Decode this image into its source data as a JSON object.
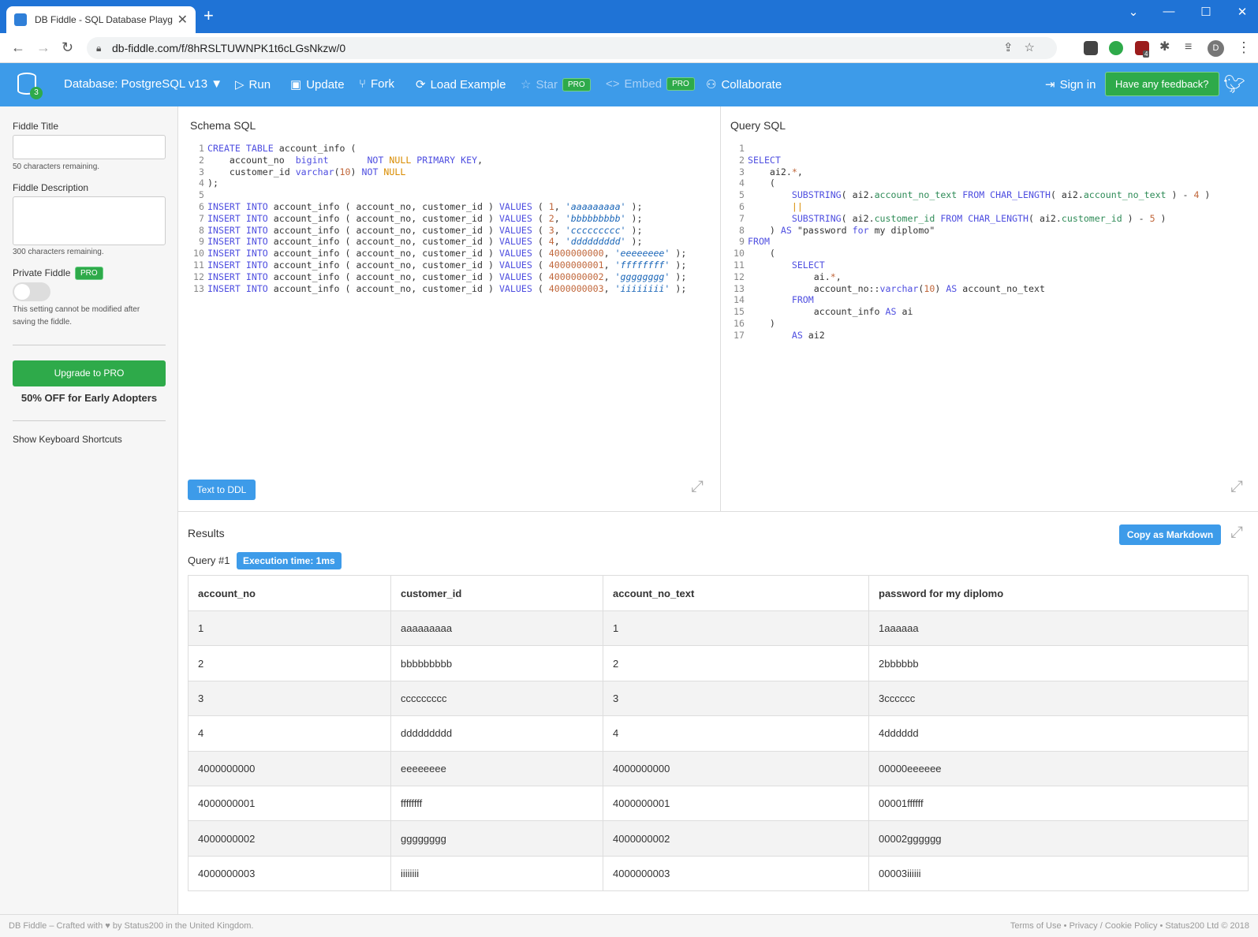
{
  "browser": {
    "tab_title": "DB Fiddle - SQL Database Playgro",
    "tab_close": "✕",
    "new_tab": "+",
    "url": "db-fiddle.com/f/8hRSLTUWNPK1t6cLGsNkzw/0",
    "avatar": "D",
    "ext_badge": "4"
  },
  "navbar": {
    "logo_badge": "3",
    "database": "Database: PostgreSQL v13 ▼",
    "run": "Run",
    "update": "Update",
    "fork": "Fork",
    "load_example": "Load Example",
    "star": "Star",
    "embed": "Embed",
    "pro": "PRO",
    "collaborate": "Collaborate",
    "sign_in": "Sign in",
    "feedback": "Have any feedback?"
  },
  "sidebar": {
    "title_label": "Fiddle Title",
    "title_hint": "50 characters remaining.",
    "desc_label": "Fiddle Description",
    "desc_hint": "300 characters remaining.",
    "private_label": "Private Fiddle",
    "private_hint_1": "This setting cannot be modified after",
    "private_hint_2": "saving the fiddle.",
    "upgrade": "Upgrade to PRO",
    "offer": "50% OFF for Early Adopters",
    "shortcuts": "Show Keyboard Shortcuts"
  },
  "schema": {
    "title": "Schema SQL",
    "text_to_ddl": "Text to DDL"
  },
  "query": {
    "title": "Query SQL"
  },
  "results": {
    "title": "Results",
    "copy_markdown": "Copy as Markdown",
    "query_label": "Query #1",
    "exec_time": "Execution time: 1ms",
    "columns": [
      "account_no",
      "customer_id",
      "account_no_text",
      "password for my diplomo"
    ],
    "rows": [
      [
        "1",
        "aaaaaaaaa",
        "1",
        "1aaaaaa"
      ],
      [
        "2",
        "bbbbbbbbb",
        "2",
        "2bbbbbb"
      ],
      [
        "3",
        "ccccccccc",
        "3",
        "3cccccc"
      ],
      [
        "4",
        "ddddddddd",
        "4",
        "4dddddd"
      ],
      [
        "4000000000",
        "eeeeeeee",
        "4000000000",
        "00000eeeeee"
      ],
      [
        "4000000001",
        "ffffffff",
        "4000000001",
        "00001ffffff"
      ],
      [
        "4000000002",
        "gggggggg",
        "4000000002",
        "00002gggggg"
      ],
      [
        "4000000003",
        "iiiiiiii",
        "4000000003",
        "00003iiiiii"
      ]
    ]
  },
  "footer": {
    "left": "DB Fiddle – Crafted with ♥ by Status200 in the United Kingdom.",
    "right": "Terms of Use • Privacy / Cookie Policy • Status200 Ltd © 2018"
  }
}
